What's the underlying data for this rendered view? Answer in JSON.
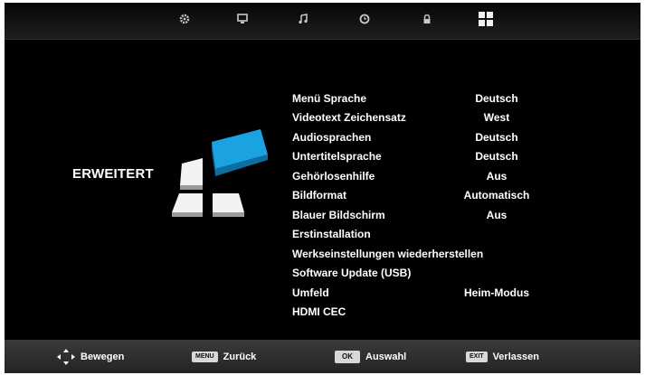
{
  "top_tabs": [
    {
      "icon": "gear-icon"
    },
    {
      "icon": "monitor-icon"
    },
    {
      "icon": "music-note-icon"
    },
    {
      "icon": "clock-icon"
    },
    {
      "icon": "lock-icon"
    },
    {
      "icon": "grid-icon",
      "active": true
    }
  ],
  "section": {
    "title": "ERWEITERT"
  },
  "menu": {
    "items": [
      {
        "label": "Menü Sprache",
        "value": "Deutsch"
      },
      {
        "label": "Videotext Zeichensatz",
        "value": "West"
      },
      {
        "label": "Audiosprachen",
        "value": "Deutsch"
      },
      {
        "label": "Untertitelsprache",
        "value": "Deutsch"
      },
      {
        "label": "Gehörlosenhilfe",
        "value": "Aus"
      },
      {
        "label": "Bildformat",
        "value": "Automatisch"
      },
      {
        "label": "Blauer Bildschirm",
        "value": "Aus"
      },
      {
        "label": "Erstinstallation",
        "value": ""
      },
      {
        "label": "Werkseinstellungen wiederherstellen",
        "value": ""
      },
      {
        "label": "Software Update (USB)",
        "value": ""
      },
      {
        "label": "Umfeld",
        "value": "Heim-Modus"
      },
      {
        "label": "HDMI CEC",
        "value": ""
      }
    ]
  },
  "bottom_hints": {
    "move": {
      "label": "Bewegen",
      "icon": "dpad-icon"
    },
    "back": {
      "key": "MENU",
      "label": "Zurück"
    },
    "select": {
      "key": "OK",
      "label": "Auswahl"
    },
    "exit": {
      "key": "EXIT",
      "label": "Verlassen"
    }
  },
  "colors": {
    "accent": "#1aa3e0",
    "background": "#000000",
    "text": "#ffffff"
  }
}
